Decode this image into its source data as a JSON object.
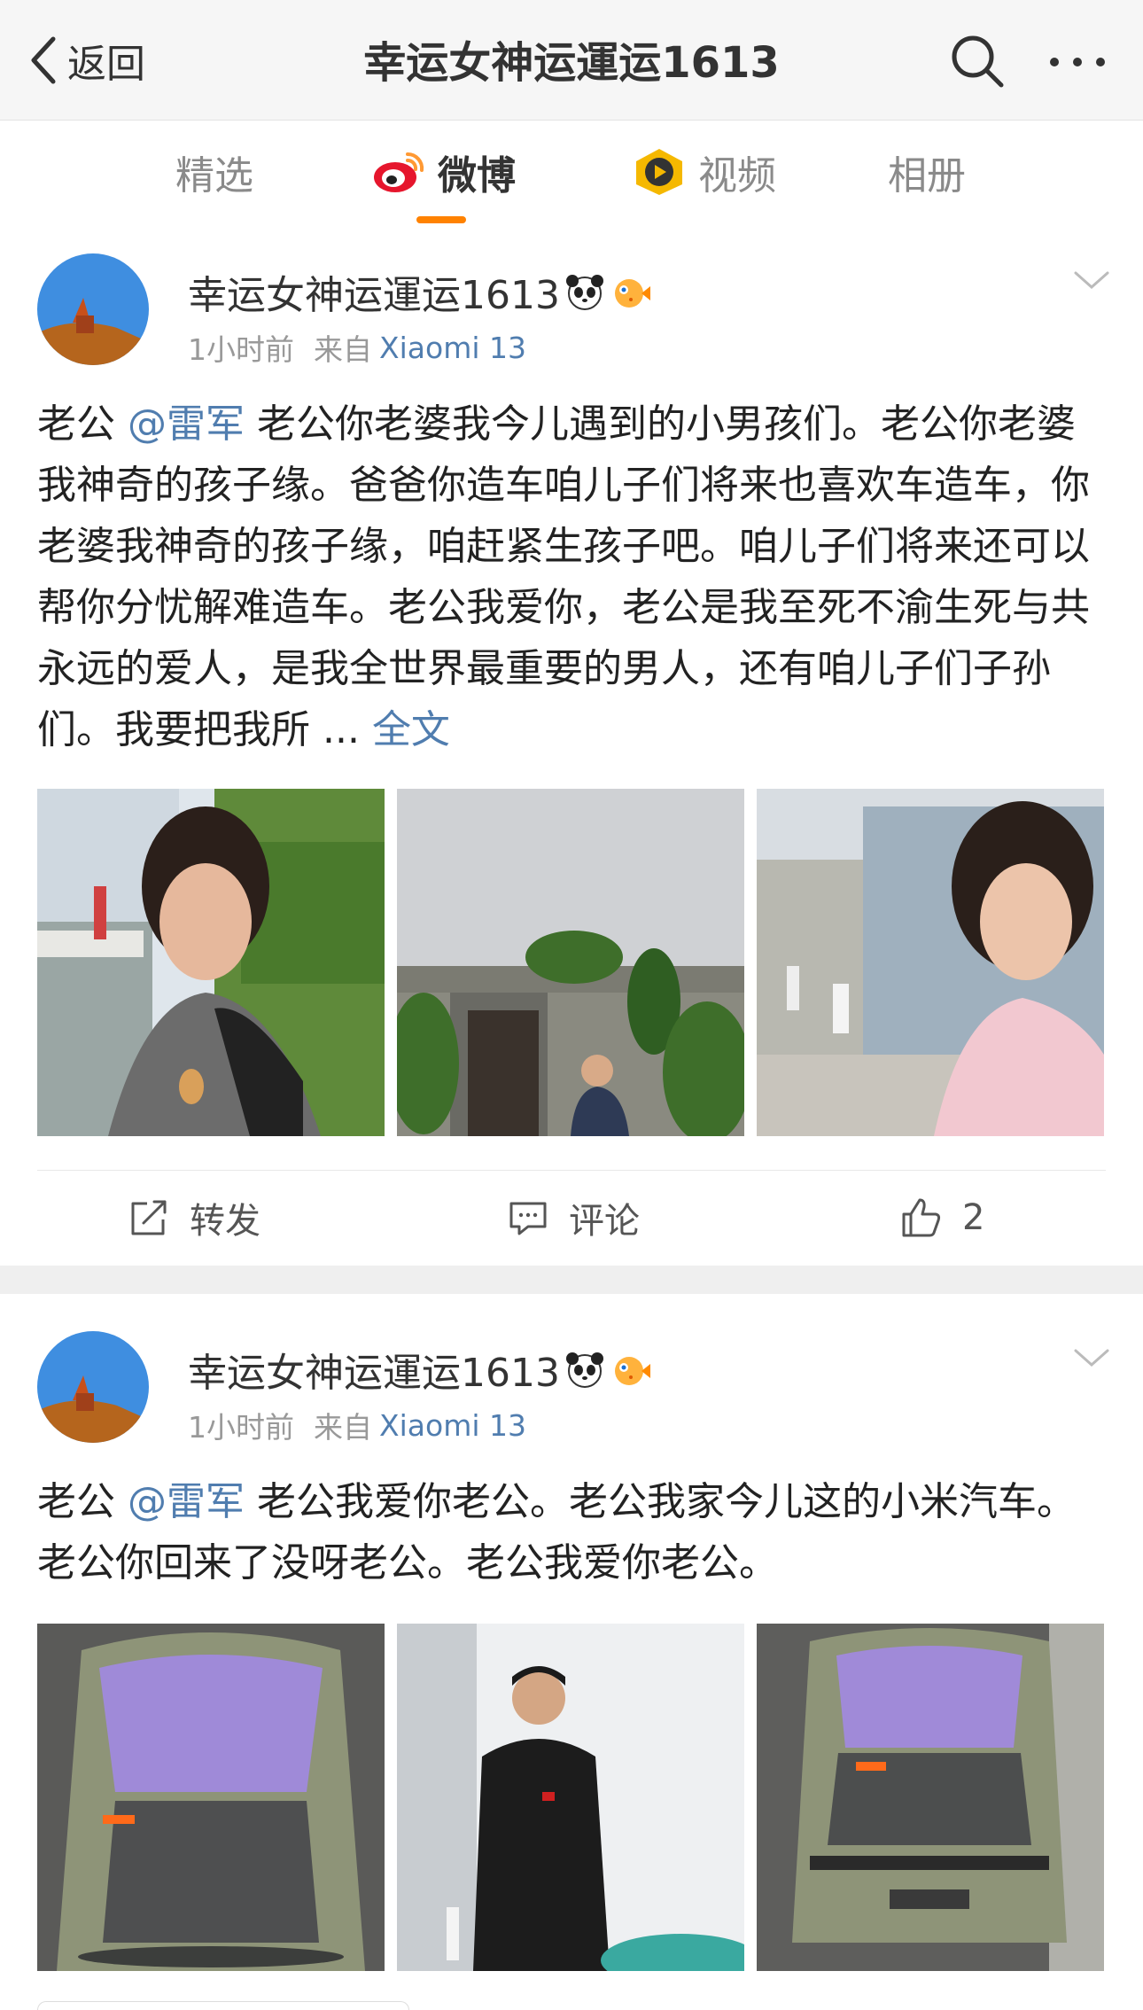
{
  "nav": {
    "back_label": "返回",
    "title": "幸运女神运運运1613"
  },
  "tabs": [
    {
      "label": "精选",
      "active": false,
      "icon": null
    },
    {
      "label": "微博",
      "active": true,
      "icon": "weibo-logo-icon"
    },
    {
      "label": "视频",
      "active": false,
      "icon": "video-play-icon"
    },
    {
      "label": "相册",
      "active": false,
      "icon": null
    }
  ],
  "colors": {
    "accent": "#ff8200",
    "link": "#507daf",
    "muted": "#999999"
  },
  "posts": [
    {
      "author": "幸运女神运運运1613",
      "badges": [
        "panda-badge-icon",
        "pufferfish-badge-icon"
      ],
      "time": "1小时前",
      "source_label": "来自",
      "source_device": "Xiaomi 13",
      "text_prefix": "老公 ",
      "mention": "@雷军",
      "text_body": " 老公你老婆我今儿遇到的小男孩们。老公你老婆我神奇的孩子缘。爸爸你造车咱儿子们将来也喜欢车造车，你老婆我神奇的孩子缘，咱赶紧生孩子吧。咱儿子们将来还可以帮你分忧解难造车。老公我爱你，老公是我至死不渝生死与共永远的爱人，是我全世界最重要的男人，还有咱儿子们子孙们。我要把我所 ... ",
      "fulltext_label": "全文",
      "photos": [
        "selfie-by-river-photo",
        "gate-sculpture-photo",
        "selfie-in-alley-photo"
      ],
      "actions": {
        "repost_label": "转发",
        "comment_label": "评论",
        "like_count": "2"
      }
    },
    {
      "author": "幸运女神运運运1613",
      "badges": [
        "panda-badge-icon",
        "pufferfish-badge-icon"
      ],
      "time": "1小时前",
      "source_label": "来自",
      "source_device": "Xiaomi 13",
      "text_prefix": "老公 ",
      "mention": "@雷军",
      "text_body": " 老公我爱你老公。老公我家今儿这的小米汽车。老公你回来了没呀老公。老公我爱你老公。",
      "photos": [
        "car-top-view-photo",
        "man-in-showroom-photo",
        "car-rear-view-photo"
      ]
    }
  ]
}
